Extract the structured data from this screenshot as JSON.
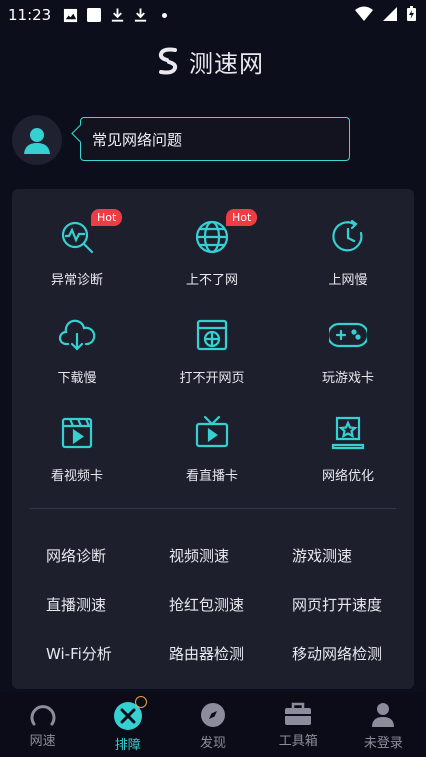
{
  "status_bar": {
    "time": "11:23"
  },
  "header": {
    "app_name": "测速网"
  },
  "faq": {
    "label": "常见网络问题"
  },
  "grid": [
    {
      "label": "异常诊断",
      "icon": "diagnosis-icon",
      "badge": "Hot"
    },
    {
      "label": "上不了网",
      "icon": "globe-icon",
      "badge": "Hot"
    },
    {
      "label": "上网慢",
      "icon": "slow-clock-icon"
    },
    {
      "label": "下载慢",
      "icon": "cloud-download-icon"
    },
    {
      "label": "打不开网页",
      "icon": "webpage-icon"
    },
    {
      "label": "玩游戏卡",
      "icon": "gamepad-icon"
    },
    {
      "label": "看视频卡",
      "icon": "video-icon"
    },
    {
      "label": "看直播卡",
      "icon": "tv-icon"
    },
    {
      "label": "网络优化",
      "icon": "optimize-icon"
    }
  ],
  "tools": [
    "网络诊断",
    "视频测速",
    "游戏测速",
    "直播测速",
    "抢红包测速",
    "网页打开速度",
    "Wi-Fi分析",
    "路由器检测",
    "移动网络检测"
  ],
  "tabs": [
    {
      "label": "网速",
      "icon": "speedometer-icon"
    },
    {
      "label": "排障",
      "icon": "tools-icon",
      "active": true
    },
    {
      "label": "发现",
      "icon": "compass-icon"
    },
    {
      "label": "工具箱",
      "icon": "toolbox-icon"
    },
    {
      "label": "未登录",
      "icon": "user-icon"
    }
  ],
  "colors": {
    "accent": "#35d0d2",
    "hot": "#ee3c44",
    "background": "#0d0e1c",
    "panel": "#1d1f2d"
  }
}
